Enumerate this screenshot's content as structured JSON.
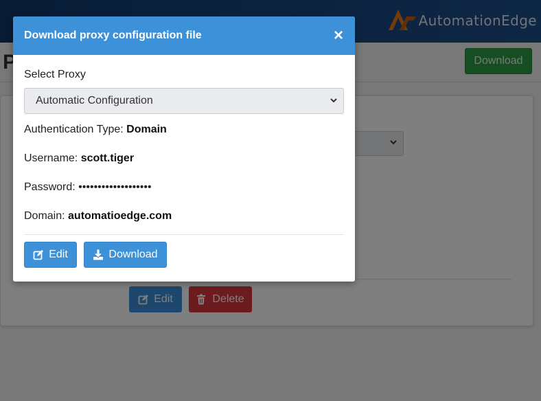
{
  "app": {
    "brand_name": "AutomationEdge",
    "page_title_visible": "P",
    "header_download_label": "Download"
  },
  "card": {
    "edit_label": "Edit",
    "delete_label": "Delete"
  },
  "modal": {
    "title": "Download proxy configuration file",
    "close_symbol": "×",
    "select_label": "Select Proxy",
    "select_value": "Automatic Configuration",
    "auth_type_label": "Authentication Type:",
    "auth_type_value": "Domain",
    "username_label": "Username:",
    "username_value": "scott.tiger",
    "password_label": "Password:",
    "password_value": "•••••••••••••••••••",
    "domain_label": "Domain:",
    "domain_value": "automatioedge.com",
    "edit_label": "Edit",
    "download_label": "Download"
  },
  "colors": {
    "primary": "#3d91d8",
    "success": "#2e9a45",
    "danger": "#d9383f",
    "topbar": "#17467f",
    "brand_accent": "#e8761a"
  },
  "icons": {
    "close": "close-icon",
    "select_chevron": "chevron-down-icon",
    "edit": "edit-icon",
    "download": "download-icon",
    "delete": "trash-icon",
    "logo": "automationedge-logo-icon"
  }
}
